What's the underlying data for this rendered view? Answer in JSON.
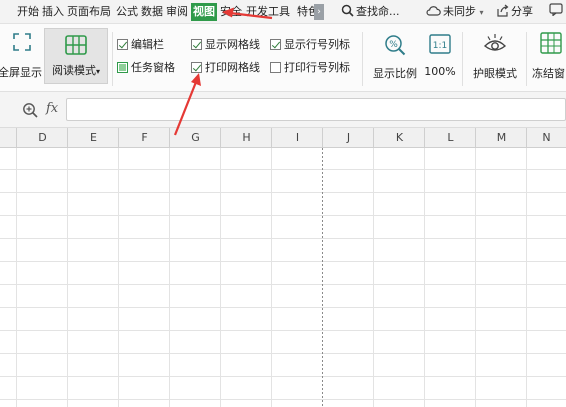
{
  "tabs": [
    {
      "label": "开始",
      "active": false
    },
    {
      "label": "插入",
      "active": false
    },
    {
      "label": "页面布局",
      "active": false
    },
    {
      "label": "公式",
      "active": false
    },
    {
      "label": "数据",
      "active": false
    },
    {
      "label": "审阅",
      "active": false
    },
    {
      "label": "视图",
      "active": true
    },
    {
      "label": "安全",
      "active": false
    },
    {
      "label": "开发工具",
      "active": false
    },
    {
      "label": "特色",
      "active": false
    }
  ],
  "toolbar": {
    "search_label": "查找命...",
    "sync_label": "未同步",
    "share_label": "分享"
  },
  "ribbon": {
    "fullscreen_label": "全屏显示",
    "read_mode_label": "阅读模式",
    "checkboxes": [
      {
        "label": "编辑栏",
        "checked": true
      },
      {
        "label": "任务窗格",
        "checked": false
      },
      {
        "label": "显示网格线",
        "checked": true
      },
      {
        "label": "打印网格线",
        "checked": true
      },
      {
        "label": "显示行号列标",
        "checked": true
      },
      {
        "label": "打印行号列标",
        "checked": false
      }
    ],
    "zoom_ratio_label": "显示比例",
    "zoom_100_label": "100%",
    "eye_mode_label": "护眼模式",
    "freeze_label": "冻结窗"
  },
  "formula_bar": {
    "fx_label": "fx",
    "value": ""
  },
  "sheet": {
    "columns": [
      "D",
      "E",
      "F",
      "G",
      "H",
      "I",
      "J",
      "K",
      "L",
      "M",
      "N"
    ]
  },
  "colors": {
    "active_tab": "#2f9a4a",
    "arrow": "#e53935",
    "checkbox_tick": "#2f7d3a"
  }
}
